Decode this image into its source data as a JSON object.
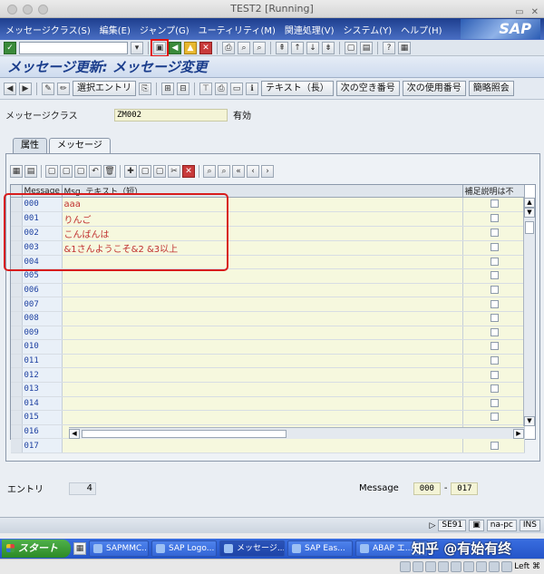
{
  "window": {
    "title": "TEST2 [Running]"
  },
  "menu": {
    "items": [
      "メッセージクラス(S)",
      "編集(E)",
      "ジャンプ(G)",
      "ユーティリティ(M)",
      "関連処理(V)",
      "システム(Y)",
      "ヘルプ(H)"
    ],
    "brand": "SAP"
  },
  "page_title": "メッセージ更新: メッセージ変更",
  "app_toolbar": {
    "buttons": [
      "選択エントリ",
      "テキスト（長）",
      "次の空き番号",
      "次の使用番号",
      "簡略照会"
    ]
  },
  "header": {
    "msg_class_label": "メッセージクラス",
    "msg_class_value": "ZM002",
    "status": "有効"
  },
  "tabs": [
    {
      "label": "属性",
      "active": false
    },
    {
      "label": "メッセージ",
      "active": true
    }
  ],
  "table": {
    "columns": [
      "Message",
      "Msg. テキスト（短）",
      "補足説明は不"
    ],
    "rows": [
      {
        "id": "000",
        "text": "aaa"
      },
      {
        "id": "001",
        "text": "りんご"
      },
      {
        "id": "002",
        "text": "こんばんは"
      },
      {
        "id": "003",
        "text": "&1さんようこそ&2 &3以上"
      },
      {
        "id": "004",
        "text": ""
      },
      {
        "id": "005",
        "text": ""
      },
      {
        "id": "006",
        "text": ""
      },
      {
        "id": "007",
        "text": ""
      },
      {
        "id": "008",
        "text": ""
      },
      {
        "id": "009",
        "text": ""
      },
      {
        "id": "010",
        "text": ""
      },
      {
        "id": "011",
        "text": ""
      },
      {
        "id": "012",
        "text": ""
      },
      {
        "id": "013",
        "text": ""
      },
      {
        "id": "014",
        "text": ""
      },
      {
        "id": "015",
        "text": ""
      },
      {
        "id": "016",
        "text": ""
      },
      {
        "id": "017",
        "text": ""
      }
    ]
  },
  "footer": {
    "entry_label": "エントリ",
    "entry_count": "4",
    "message_label": "Message",
    "range_from": "000",
    "range_sep": "-",
    "range_to": "017"
  },
  "status_bar": {
    "tx": "SE91",
    "host": "na-pc",
    "mode": "INS"
  },
  "taskbar": {
    "start": "スタート",
    "tasks": [
      "SAPMMC...",
      "SAP Logo...",
      "メッセージ...",
      "SAP Eas...",
      "ABAP エ..."
    ],
    "watermark": "知乎 @有始有终"
  },
  "mac_bar": {
    "key_hint": "Left ⌘"
  },
  "colors": {
    "highlight_box": "#d81c1c",
    "msg_text": "#c03030",
    "sap_blue": "#1d3e8e"
  }
}
